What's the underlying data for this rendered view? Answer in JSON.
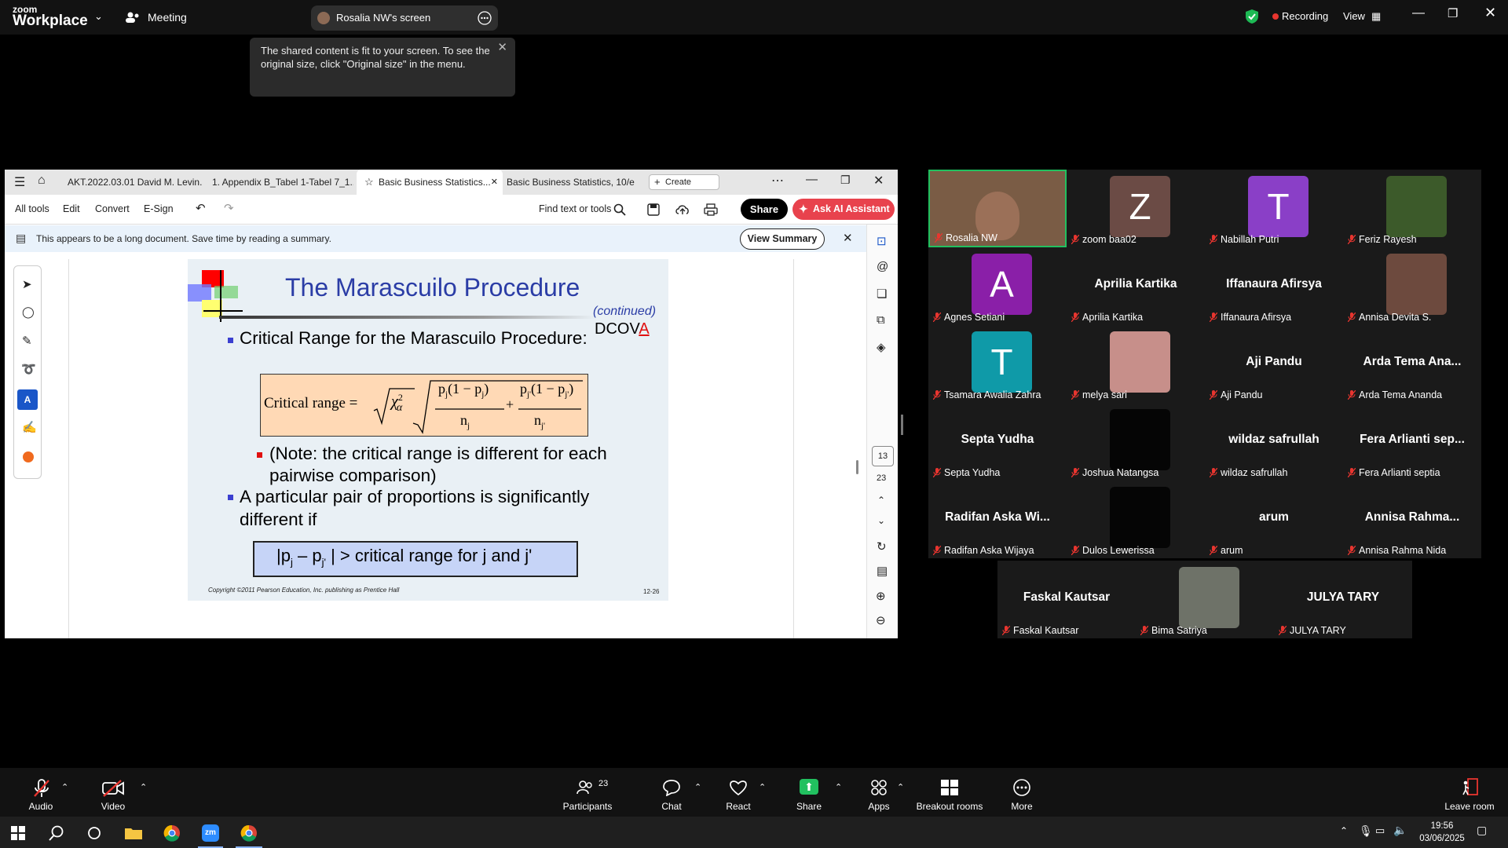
{
  "zoom": {
    "brand_top": "zoom",
    "brand_bottom": "Workplace",
    "meeting_label": "Meeting",
    "share_pill_label": "Rosalia NW's screen",
    "recording_label": "Recording",
    "view_label": "View",
    "tooltip_text": "The shared content is fit to your screen. To see the original size, click \"Original size\" in the menu."
  },
  "acrobat": {
    "tabs": [
      {
        "label": "AKT.2022.03.01 David M. Levin..."
      },
      {
        "label": "1. Appendix B_Tabel 1-Tabel 7_1..."
      },
      {
        "label": "Basic Business Statistics..."
      },
      {
        "label": "Basic Business Statistics, 10/e"
      }
    ],
    "create_label": "Create",
    "tools": [
      "All tools",
      "Edit",
      "Convert",
      "E-Sign"
    ],
    "find_label": "Find text or tools",
    "share_label": "Share",
    "ai_label": "Ask AI Assistant",
    "banner_text": "This appears to be a long document. Save time by reading a summary.",
    "view_summary_label": "View Summary",
    "page_current": "13",
    "page_total": "23"
  },
  "slide": {
    "title": "The Marascuilo Procedure",
    "continued": "(continued)",
    "dcova_prefix": "DCOV",
    "dcova_red": "A",
    "bullet1": "Critical Range for the Marascuilo Procedure:",
    "formula_lhs": "Critical range =",
    "formula_sqrt_sym": "χ",
    "formula_sup": "2",
    "formula_sub_alpha": "α",
    "formula_num1": "p",
    "formula_num1_sub": "j",
    "formula_num1_rest": "(1 − p",
    "formula_num1_close": ")",
    "formula_den1": "n",
    "formula_den1_sub": "j",
    "formula_plus": "+",
    "formula_num2": "p",
    "formula_num2_sub": "j'",
    "formula_num2_rest": "(1 − p",
    "formula_num2_close": ")",
    "formula_den2": "n",
    "formula_den2_sub": "j'",
    "note": "(Note:  the critical range is different for each pairwise comparison)",
    "bullet2": "A particular pair of proportions is significantly different if",
    "box_lhs_bar": "|",
    "box_p1": "p",
    "box_p1_sub": "j",
    "box_minus": "– p",
    "box_p2_sub": "j'",
    "box_rhs": "|  >  critical range for j and j'",
    "copyright": "Copyright ©2011 Pearson Education, Inc. publishing as Prentice Hall",
    "slide_no": "12-26"
  },
  "participants": [
    {
      "name": "Rosalia NW",
      "kind": "video",
      "color": "#7a5c45"
    },
    {
      "name": "zoom baa02",
      "kind": "avatar",
      "letter": "Z",
      "color": "#6b4b45"
    },
    {
      "name": "Nabillah Putri",
      "kind": "avatar",
      "letter": "T",
      "color": "#8a3fc7"
    },
    {
      "name": "Feriz Rayesh",
      "kind": "photo",
      "color": "#3c5a2a"
    },
    {
      "name": "Agnes Setiani",
      "kind": "avatar",
      "letter": "A",
      "color": "#8a1fa8"
    },
    {
      "name": "Aprilia Kartika",
      "kind": "text",
      "big": "Aprilia Kartika"
    },
    {
      "name": "Iffanaura Afirsya",
      "kind": "text",
      "big": "Iffanaura Afirsya"
    },
    {
      "name": "Annisa Devita S.",
      "kind": "photo",
      "color": "#6d4a3e"
    },
    {
      "name": "Tsamara Awalia Zahra",
      "kind": "avatar",
      "letter": "T",
      "color": "#0f9aa8"
    },
    {
      "name": "melya sari",
      "kind": "photo",
      "color": "#c78f8a"
    },
    {
      "name": "Aji Pandu",
      "kind": "text",
      "big": "Aji Pandu"
    },
    {
      "name": "Arda Tema Ananda",
      "kind": "text",
      "big": "Arda Tema Ana..."
    },
    {
      "name": "Septa Yudha",
      "kind": "text",
      "big": "Septa Yudha"
    },
    {
      "name": "Joshua Natangsa",
      "kind": "photo",
      "color": "#050505"
    },
    {
      "name": "wildaz safrullah",
      "kind": "text",
      "big": "wildaz safrullah"
    },
    {
      "name": "Fera Arlianti septia",
      "kind": "text",
      "big": "Fera Arlianti sep..."
    },
    {
      "name": "Radifan Aska Wijaya",
      "kind": "text",
      "big": "Radifan Aska Wi..."
    },
    {
      "name": "Dulos Lewerissa",
      "kind": "photo",
      "color": "#050505"
    },
    {
      "name": "arum",
      "kind": "text",
      "big": "arum"
    },
    {
      "name": "Annisa Rahma Nida",
      "kind": "text",
      "big": "Annisa Rahma..."
    },
    {
      "name": "Faskal Kautsar",
      "kind": "text",
      "big": "Faskal Kautsar"
    },
    {
      "name": "Bima Satriya",
      "kind": "photo",
      "color": "#6e7268"
    },
    {
      "name": "JULYA TARY",
      "kind": "text",
      "big": "JULYA TARY"
    }
  ],
  "bottom": {
    "audio": "Audio",
    "video": "Video",
    "participants_count": "23",
    "participants": "Participants",
    "chat": "Chat",
    "react": "React",
    "share": "Share",
    "apps": "Apps",
    "breakout": "Breakout rooms",
    "more": "More",
    "leave": "Leave room"
  },
  "taskbar": {
    "time": "19:56",
    "date": "03/06/2025"
  }
}
